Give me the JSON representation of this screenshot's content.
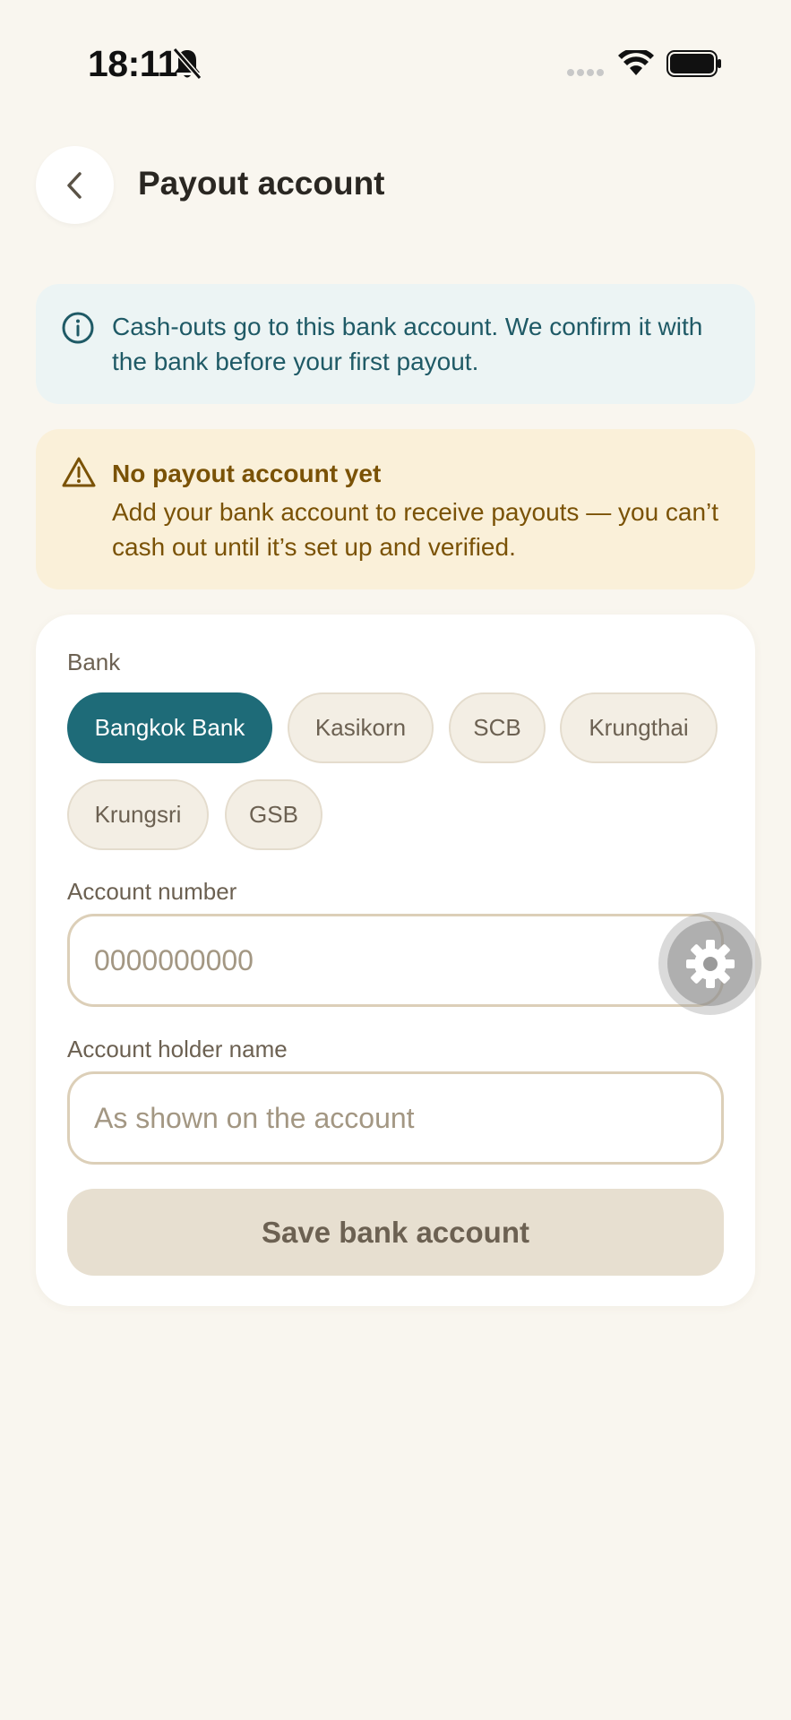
{
  "status_bar": {
    "time": "18:11"
  },
  "header": {
    "title": "Payout account",
    "back_icon": "chevron-left-icon"
  },
  "info_banner": {
    "icon": "info-icon",
    "text": "Cash-outs go to this bank account. We confirm it with the bank before your first payout."
  },
  "warning_banner": {
    "icon": "warning-triangle-icon",
    "title": "No payout account yet",
    "text": "Add your bank account to receive payouts — you can’t cash out until it’s set up and verified."
  },
  "form": {
    "bank_label": "Bank",
    "banks": [
      {
        "label": "Bangkok Bank",
        "selected": true
      },
      {
        "label": "Kasikorn",
        "selected": false
      },
      {
        "label": "SCB",
        "selected": false
      },
      {
        "label": "Krungthai",
        "selected": false
      },
      {
        "label": "Krungsri",
        "selected": false
      },
      {
        "label": "GSB",
        "selected": false
      }
    ],
    "account_number_label": "Account number",
    "account_number_placeholder": "0000000000",
    "account_number_value": "",
    "holder_name_label": "Account holder name",
    "holder_name_placeholder": "As shown on the account",
    "holder_name_value": "",
    "save_label": "Save bank account"
  },
  "floating_button": {
    "icon": "gear-icon"
  },
  "colors": {
    "background": "#f9f6ef",
    "accent": "#1e6b78",
    "info_bg": "#ecf4f4",
    "info_text": "#1f5a66",
    "warning_bg": "#faf0d9",
    "warning_text": "#7a5206",
    "button_disabled_bg": "#e7dfd0"
  }
}
